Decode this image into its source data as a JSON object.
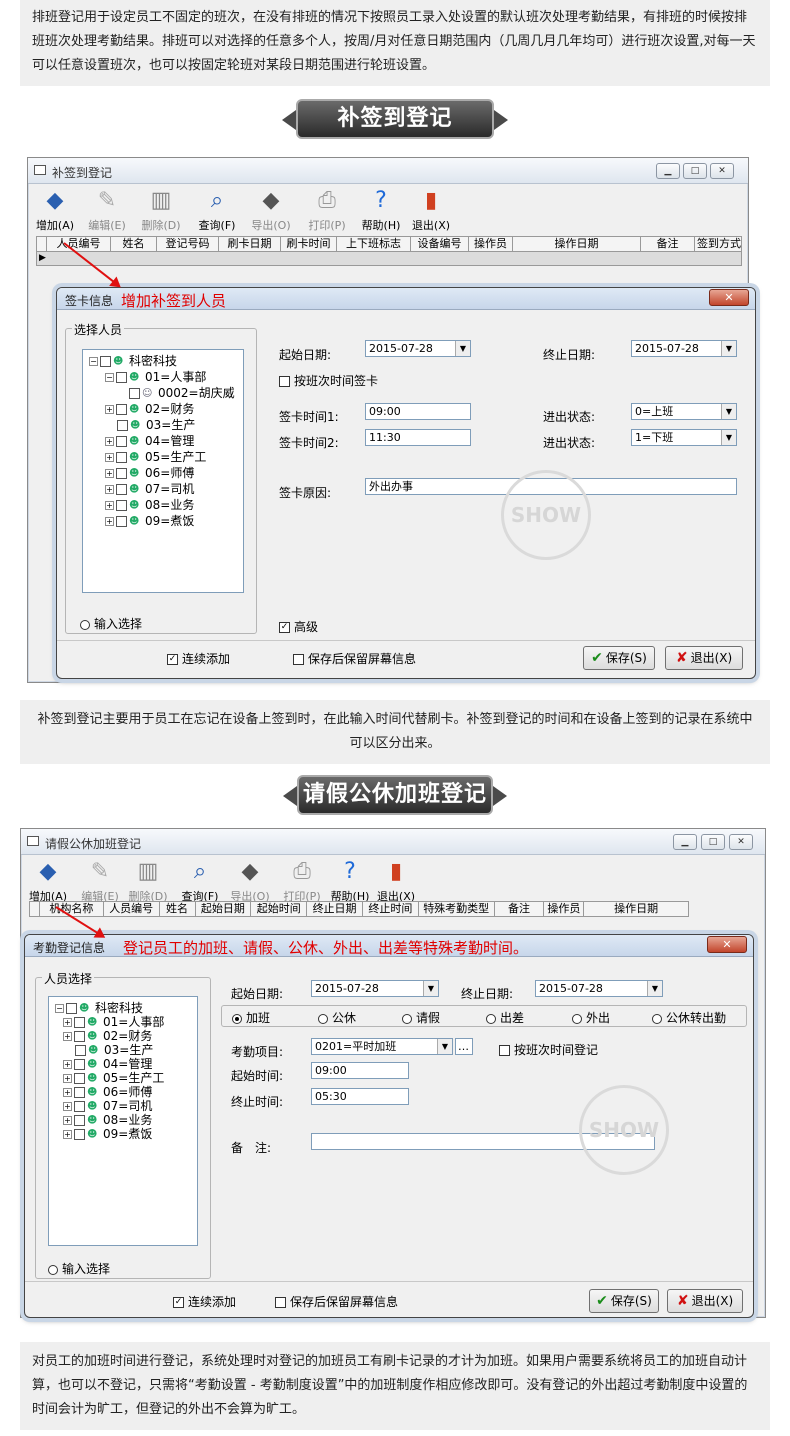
{
  "intro_text": "排班登记用于设定员工不固定的班次，在没有排班的情况下按照员工录入处设置的默认班次处理考勤结果，有排班的时候按排班班次处理考勤结果。排班可以对选择的任意多个人，按周/月对任意日期范围内（几周几月几年均可）进行班次设置,对每一天可以任意设置班次，也可以按固定轮班对某段日期范围进行轮班设置。",
  "section1": {
    "banner": "补签到登记",
    "window_title": "补签到登记",
    "toolbar": [
      {
        "label": "增加(A)",
        "icon": "add-cards-icon",
        "enabled": true
      },
      {
        "label": "编辑(E)",
        "icon": "edit-icon",
        "enabled": false
      },
      {
        "label": "删除(D)",
        "icon": "trash-icon",
        "enabled": false
      },
      {
        "label": "查询(F)",
        "icon": "search-icon",
        "enabled": true
      },
      {
        "label": "导出(O)",
        "icon": "export-icon",
        "enabled": false
      },
      {
        "label": "打印(P)",
        "icon": "printer-icon",
        "enabled": false
      },
      {
        "label": "帮助(H)",
        "icon": "help-icon",
        "enabled": true
      },
      {
        "label": "退出(X)",
        "icon": "exit-book-icon",
        "enabled": true
      }
    ],
    "columns": [
      "人员编号",
      "姓名",
      "登记号码",
      "刷卡日期",
      "刷卡时间",
      "上下班标志",
      "设备编号",
      "操作员",
      "操作日期",
      "备注",
      "签到方式"
    ],
    "dialog": {
      "title": "签卡信息",
      "annotation": "增加补签到人员",
      "select_group": "选择人员",
      "tree": [
        {
          "label": "科密科技",
          "level": 0,
          "expanded": true
        },
        {
          "label": "01=人事部",
          "level": 1,
          "expanded": true
        },
        {
          "label": "0002=胡庆威",
          "level": 2,
          "person": true
        },
        {
          "label": "02=财务",
          "level": 1
        },
        {
          "label": "03=生产",
          "level": 1
        },
        {
          "label": "04=管理",
          "level": 1
        },
        {
          "label": "05=生产工",
          "level": 1
        },
        {
          "label": "06=师傅",
          "level": 1
        },
        {
          "label": "07=司机",
          "level": 1
        },
        {
          "label": "08=业务",
          "level": 1
        },
        {
          "label": "09=煮饭",
          "level": 1
        }
      ],
      "input_select": "输入选择",
      "start_date_label": "起始日期:",
      "start_date": "2015-07-28",
      "end_date_label": "终止日期:",
      "end_date": "2015-07-28",
      "by_shift_label": "按班次时间签卡",
      "time1_label": "签卡时间1:",
      "time1": "09:00",
      "time2_label": "签卡时间2:",
      "time2": "11:30",
      "inout1_label": "进出状态:",
      "inout1": "0=上班",
      "inout2_label": "进出状态:",
      "inout2": "1=下班",
      "reason_label": "签卡原因:",
      "reason": "外出办事",
      "advanced_label": "高级",
      "continuous_label": "连续添加",
      "keep_label": "保存后保留屏幕信息",
      "save_label": "保存(S)",
      "exit_label": "退出(X)"
    },
    "description": "补签到登记主要用于员工在忘记在设备上签到时，在此输入时间代替刷卡。补签到登记的时间和在设备上签到的记录在系统中可以区分出来。"
  },
  "section2": {
    "banner": "请假公休加班登记",
    "window_title": "请假公休加班登记",
    "toolbar": [
      {
        "label": "增加(A)",
        "icon": "add-cards-icon",
        "enabled": true
      },
      {
        "label": "编辑(E)",
        "icon": "edit-icon",
        "enabled": false
      },
      {
        "label": "删除(D)",
        "icon": "trash-icon",
        "enabled": false
      },
      {
        "label": "查询(F)",
        "icon": "search-icon",
        "enabled": true
      },
      {
        "label": "导出(O)",
        "icon": "export-icon",
        "enabled": false
      },
      {
        "label": "打印(P)",
        "icon": "printer-icon",
        "enabled": false
      },
      {
        "label": "帮助(H)",
        "icon": "help-icon",
        "enabled": true
      },
      {
        "label": "退出(X)",
        "icon": "exit-book-icon",
        "enabled": true
      }
    ],
    "columns": [
      "机构名称",
      "人员编号",
      "姓名",
      "起始日期",
      "起始时间",
      "终止日期",
      "终止时间",
      "特殊考勤类型",
      "备注",
      "操作员",
      "操作日期"
    ],
    "dialog": {
      "title": "考勤登记信息",
      "annotation": "登记员工的加班、请假、公休、外出、出差等特殊考勤时间。",
      "select_group": "人员选择",
      "tree": [
        {
          "label": "科密科技",
          "level": 0,
          "expanded": true
        },
        {
          "label": "01=人事部",
          "level": 1
        },
        {
          "label": "02=财务",
          "level": 1
        },
        {
          "label": "03=生产",
          "level": 1
        },
        {
          "label": "04=管理",
          "level": 1
        },
        {
          "label": "05=生产工",
          "level": 1
        },
        {
          "label": "06=师傅",
          "level": 1
        },
        {
          "label": "07=司机",
          "level": 1
        },
        {
          "label": "08=业务",
          "level": 1
        },
        {
          "label": "09=煮饭",
          "level": 1
        }
      ],
      "input_select": "输入选择",
      "start_date_label": "起始日期:",
      "start_date": "2015-07-28",
      "end_date_label": "终止日期:",
      "end_date": "2015-07-28",
      "types": [
        "加班",
        "公休",
        "请假",
        "出差",
        "外出",
        "公休转出勤"
      ],
      "selected_type": "加班",
      "item_label": "考勤项目:",
      "item_value": "0201=平时加班",
      "by_shift_label": "按班次时间登记",
      "start_time_label": "起始时间:",
      "start_time": "09:00",
      "end_time_label": "终止时间:",
      "end_time": "05:30",
      "remark_label": "备　注:",
      "remark": "",
      "continuous_label": "连续添加",
      "keep_label": "保存后保留屏幕信息",
      "save_label": "保存(S)",
      "exit_label": "退出(X)"
    },
    "description": "对员工的加班时间进行登记，系统处理时对登记的加班员工有刷卡记录的才计为加班。如果用户需要系统将员工的加班自动计算，也可以不登记，只需将“考勤设置 - 考勤制度设置”中的加班制度作相应修改即可。没有登记的外出超过考勤制度中设置的时间会计为旷工，但登记的外出不会算为旷工。"
  },
  "watermark": "SHOW",
  "colors": {
    "annotation": "#e00000",
    "banner": "#3a3a3a",
    "panel": "#efefef"
  }
}
